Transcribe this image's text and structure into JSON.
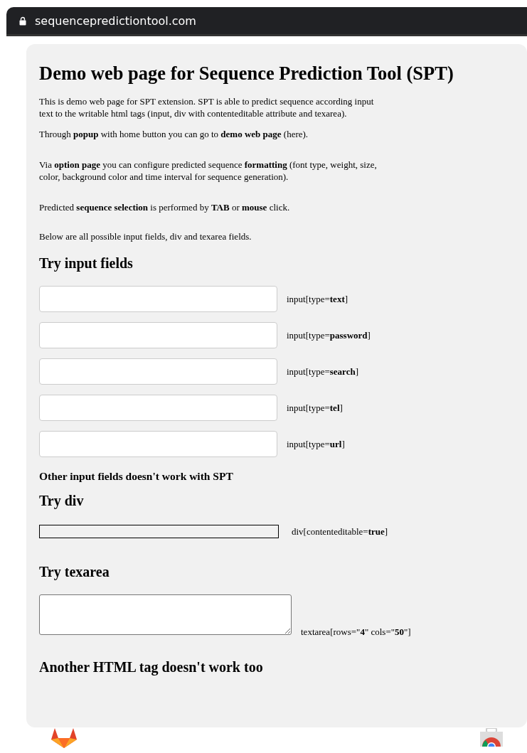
{
  "address_bar": {
    "url": "sequencepredictiontool.com"
  },
  "page": {
    "title": "Demo web page for Sequence Prediction Tool (SPT)",
    "paragraphs": [
      "This is demo web page for SPT extension. SPT is able to predict sequence according input text to the writable html tags (input, div with contenteditable attribute and texarea).",
      "Through **popup** with home button you can go to **demo web page** (here).",
      "Via **option page** you can configure predicted sequence **formatting** (font type, weight, size, color, background color and time interval for sequence generation).",
      "Predicted **sequence selection** is performed by **TAB** or **mouse** click.",
      "Below are all possible input fields, div and texarea fields."
    ],
    "sections": [
      {
        "heading": "Try input fields",
        "kind": "inputs",
        "fields": [
          {
            "label": "input[type=**text**]"
          },
          {
            "label": "input[type=**password**]"
          },
          {
            "label": "input[type=**search**]"
          },
          {
            "label": "input[type=**tel**]"
          },
          {
            "label": "input[type=**url**]"
          }
        ],
        "note": "Other input fields doesn't work with SPT"
      },
      {
        "heading": "Try div",
        "kind": "div",
        "fields": [
          {
            "label": "div[contenteditable=**true**]"
          }
        ]
      },
      {
        "heading": "Try texarea",
        "kind": "textarea",
        "fields": [
          {
            "label": "textarea[rows=\"**4**\" cols=\"**50**\"]"
          }
        ]
      },
      {
        "heading": "Another HTML tag doesn't work too",
        "kind": "heading"
      }
    ]
  }
}
